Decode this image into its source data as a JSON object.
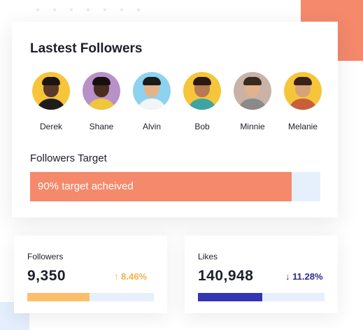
{
  "decor": {
    "orange": "#f4896b",
    "light_blue": "#e4eefc"
  },
  "followers_card": {
    "title": "Lastest Followers",
    "followers": [
      {
        "name": "Derek",
        "bg": "#f6c53a",
        "skin": "#5a3a28",
        "hair": "#1f1410",
        "shirt": "#1d1d1d"
      },
      {
        "name": "Shane",
        "bg": "#b791c8",
        "skin": "#4a2d1f",
        "hair": "#171010",
        "shirt": "#f0c63a"
      },
      {
        "name": "Alvin",
        "bg": "#8dd2ee",
        "skin": "#e2b48c",
        "hair": "#1b1b1b",
        "shirt": "#f4f4f4"
      },
      {
        "name": "Bob",
        "bg": "#f6c53a",
        "skin": "#b77a52",
        "hair": "#2a1a12",
        "shirt": "#3ea3a3"
      },
      {
        "name": "Minnie",
        "bg": "#c9b2a7",
        "skin": "#e0b38c",
        "hair": "#3a2a20",
        "shirt": "#8a8a8a"
      },
      {
        "name": "Melanie",
        "bg": "#f6c53a",
        "skin": "#d7a27a",
        "hair": "#3a2218",
        "shirt": "#c7603a"
      }
    ],
    "target": {
      "label": "Followers Target",
      "text": "90% target acheived",
      "percent": 90,
      "fill_color": "#f4896b",
      "track_color": "#e6f0fd"
    }
  },
  "stats": [
    {
      "label": "Followers",
      "value": "9,350",
      "change": "8.46%",
      "direction": "up",
      "arrow": "↑",
      "change_color": "#f5b24d",
      "progress": 0.49,
      "fill_color": "#fdbe6b",
      "track_color": "#e6f0fd"
    },
    {
      "label": "Likes",
      "value": "140,948",
      "change": "11.28%",
      "direction": "down",
      "arrow": "↓",
      "change_color": "#2a2d8c",
      "progress": 0.51,
      "fill_color": "#3435b5",
      "track_color": "#e6f0fd"
    }
  ]
}
